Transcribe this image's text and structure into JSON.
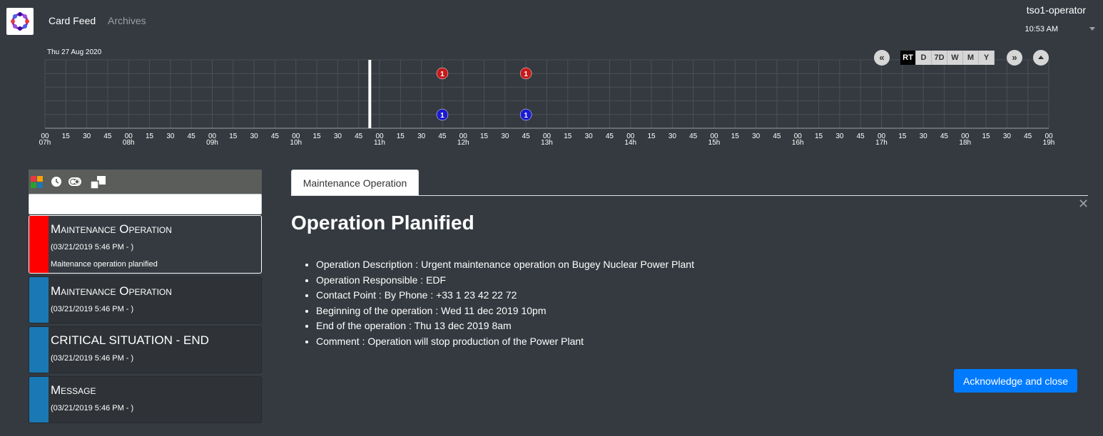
{
  "header": {
    "nav": {
      "card_feed": "Card Feed",
      "archives": "Archives"
    },
    "user": {
      "name": "tso1-operator",
      "time": "10:53 AM"
    }
  },
  "timeline": {
    "date": "Thu 27 Aug 2020",
    "hours": [
      "07h",
      "08h",
      "09h",
      "10h",
      "11h",
      "12h",
      "13h",
      "14h",
      "15h",
      "16h",
      "17h",
      "18h",
      "19h"
    ],
    "minute_labels": [
      "00",
      "15",
      "30",
      "45"
    ],
    "current_time": "10:53",
    "bubbles": [
      {
        "time": "11:45",
        "severity": "alarm",
        "count": "1",
        "color": "#c61a1a"
      },
      {
        "time": "12:45",
        "severity": "alarm",
        "count": "1",
        "color": "#c61a1a"
      },
      {
        "time": "11:45",
        "severity": "information",
        "count": "1",
        "color": "#1a1acf"
      },
      {
        "time": "12:45",
        "severity": "information",
        "count": "1",
        "color": "#1a1acf"
      }
    ],
    "controls": {
      "prev_icon": "double-chevron-left-icon",
      "next_icon": "double-chevron-right-icon",
      "collapse_icon": "caret-up-icon",
      "modes": [
        "RT",
        "D",
        "7D",
        "W",
        "M",
        "Y"
      ],
      "active_mode": "RT"
    }
  },
  "feed": {
    "toolbar_icons": [
      "type-filter-icon",
      "clock-icon",
      "toggle-icon",
      "copy-icon"
    ],
    "search": {
      "value": "",
      "placeholder": ""
    },
    "cards": [
      {
        "title": "Maintenance Operation",
        "date": "(03/21/2019 5:46 PM - )",
        "summary": "Maitenance operation planified",
        "color": "#ff0000",
        "selected": true
      },
      {
        "title": "Maintenance Operation",
        "date": "(03/21/2019 5:46 PM - )",
        "summary": "",
        "color": "#1a78b4",
        "selected": false
      },
      {
        "title": "CRITICAL SITUATION - END",
        "date": "(03/21/2019 5:46 PM - )",
        "summary": "",
        "color": "#1a78b4",
        "selected": false
      },
      {
        "title": "Message",
        "date": "(03/21/2019 5:46 PM - )",
        "summary": "",
        "color": "#1a78b4",
        "selected": false
      }
    ]
  },
  "detail": {
    "tab": "Maintenance Operation",
    "close_icon": "close-icon",
    "title": "Operation Planified",
    "items": [
      "Operation Description : Urgent maintenance operation on Bugey Nuclear Power Plant",
      "Operation Responsible : EDF",
      "Contact Point : By Phone : +33 1 23 42 22 72",
      "Beginning of the operation : Wed 11 dec 2019 10pm",
      "End of the operation : Thu 13 dec 2019 8am",
      "Comment : Operation will stop production of the Power Plant"
    ],
    "ack_label": "Acknowledge and close"
  }
}
